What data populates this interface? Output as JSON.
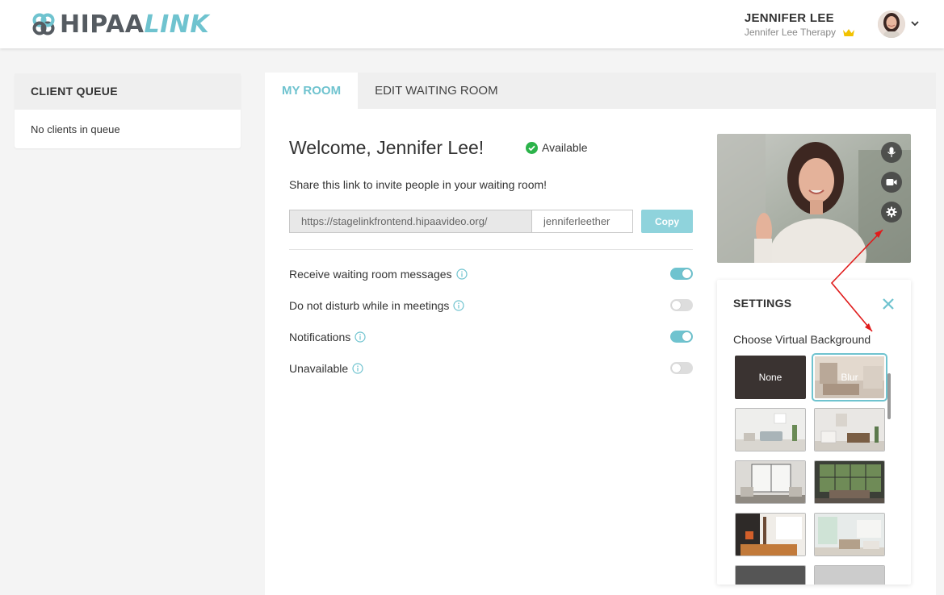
{
  "header": {
    "logo_main": "HIPAA",
    "logo_accent": "LINK",
    "user_name": "JENNIFER LEE",
    "user_org": "Jennifer Lee Therapy"
  },
  "queue": {
    "title": "CLIENT QUEUE",
    "empty_text": "No clients in queue"
  },
  "tabs": [
    {
      "label": "MY ROOM",
      "active": true
    },
    {
      "label": "EDIT WAITING ROOM",
      "active": false
    }
  ],
  "room": {
    "welcome": "Welcome, Jennifer Lee!",
    "status": "Available",
    "share_text": "Share this link to invite people in your waiting room!",
    "link_base": "https://stagelinkfrontend.hipaavideo.org/",
    "link_slug": "jenniferleether",
    "copy_label": "Copy",
    "options": [
      {
        "label": "Receive waiting room messages",
        "on": true
      },
      {
        "label": "Do not disturb while in meetings",
        "on": false
      },
      {
        "label": "Notifications",
        "on": true
      },
      {
        "label": "Unavailable",
        "on": false
      }
    ]
  },
  "settings": {
    "title": "SETTINGS",
    "subtitle": "Choose Virtual Background",
    "none_label": "None",
    "blur_label": "Blur"
  },
  "colors": {
    "accent": "#6fc3cf",
    "available": "#2bb34a",
    "annotation": "#e01b1b"
  }
}
